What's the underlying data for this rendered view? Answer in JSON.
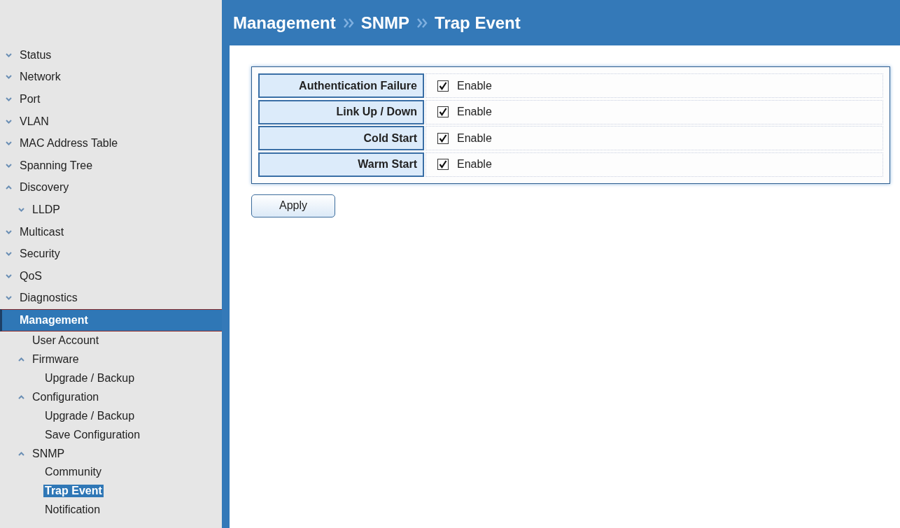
{
  "header": {
    "breadcrumb": [
      "Management",
      "SNMP",
      "Trap Event"
    ]
  },
  "sidebar": {
    "items": [
      {
        "label": "Status",
        "expanded": false,
        "selected": false
      },
      {
        "label": "Network",
        "expanded": false,
        "selected": false
      },
      {
        "label": "Port",
        "expanded": false,
        "selected": false
      },
      {
        "label": "VLAN",
        "expanded": false,
        "selected": false
      },
      {
        "label": "MAC Address Table",
        "expanded": false,
        "selected": false
      },
      {
        "label": "Spanning Tree",
        "expanded": false,
        "selected": false
      },
      {
        "label": "Discovery",
        "expanded": true,
        "selected": false,
        "children": [
          {
            "label": "LLDP",
            "expanded": false,
            "selected": false
          }
        ]
      },
      {
        "label": "Multicast",
        "expanded": false,
        "selected": false
      },
      {
        "label": "Security",
        "expanded": false,
        "selected": false
      },
      {
        "label": "QoS",
        "expanded": false,
        "selected": false
      },
      {
        "label": "Diagnostics",
        "expanded": false,
        "selected": false
      },
      {
        "label": "Management",
        "selected": true,
        "children": [
          {
            "label": "User Account",
            "selected": false
          },
          {
            "label": "Firmware",
            "expanded": true,
            "selected": false,
            "children": [
              {
                "label": "Upgrade / Backup",
                "selected": false
              }
            ]
          },
          {
            "label": "Configuration",
            "expanded": true,
            "selected": false,
            "children": [
              {
                "label": "Upgrade / Backup",
                "selected": false
              },
              {
                "label": "Save Configuration",
                "selected": false
              }
            ]
          },
          {
            "label": "SNMP",
            "expanded": true,
            "selected": false,
            "children": [
              {
                "label": "Community",
                "selected": false
              },
              {
                "label": "Trap Event",
                "selected": true
              },
              {
                "label": "Notification",
                "selected": false
              }
            ]
          }
        ]
      }
    ]
  },
  "trap_events": [
    {
      "label": "Authentication Failure",
      "checked": true,
      "option": "Enable"
    },
    {
      "label": "Link Up / Down",
      "checked": true,
      "option": "Enable"
    },
    {
      "label": "Cold Start",
      "checked": true,
      "option": "Enable"
    },
    {
      "label": "Warm Start",
      "checked": true,
      "option": "Enable"
    }
  ],
  "apply_button": "Apply"
}
